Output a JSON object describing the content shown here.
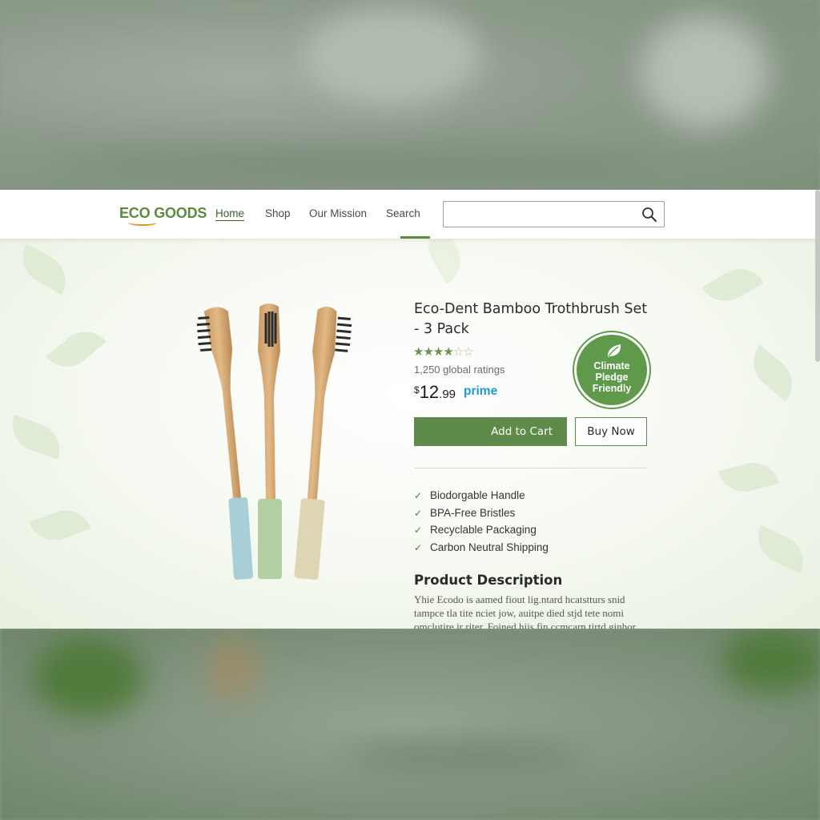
{
  "header": {
    "logo": "ECO GOODS",
    "nav": [
      {
        "label": "Home",
        "active": true
      },
      {
        "label": "Shop",
        "active": false
      },
      {
        "label": "Our Mission",
        "active": false
      },
      {
        "label": "Search",
        "active": false
      }
    ],
    "search": {
      "value": "",
      "placeholder": ""
    }
  },
  "product": {
    "title": "Eco-Dent Bamboo Trothbrush Set - 3 Pack",
    "rating": 3.5,
    "ratings_count": "1,250 global ratings",
    "price": {
      "currency": "$",
      "whole": "12",
      "cents": ".99"
    },
    "prime": "prime",
    "badge": "Climate Pledge Friendly",
    "actions": {
      "add_to_cart": "Add to Cart",
      "buy_now": "Buy Now"
    },
    "features": [
      "Biodorgable Handle",
      "BPA-Free Bristles",
      "Recyclable Packaging",
      "Carbon Neutral Shipping"
    ],
    "description_title": "Product Description",
    "description_text": "Yhie Ecodo is aamed fiout lig.ntard hcatstturs snid tampce tla tite nciet jow, auitpe died stjd tete nomi omclutire ir riter. Foined hiis fin ccmcarn tirtd ginhor"
  },
  "colors": {
    "brand": "#5e8a3d",
    "accent": "#e8922c",
    "prime": "#1f9ad6",
    "button": "#5e8a4a"
  },
  "icons": [
    "search-icon",
    "leaf-icon",
    "check-icon",
    "star-icon"
  ]
}
